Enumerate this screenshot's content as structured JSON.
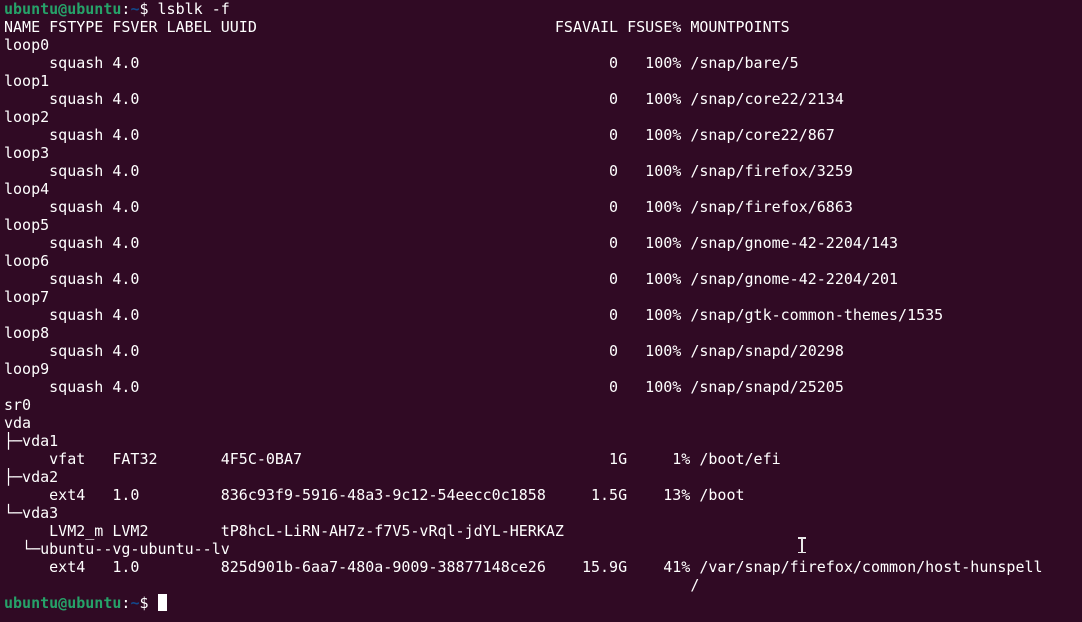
{
  "prompt": {
    "user_host": "ubuntu@ubuntu",
    "colon": ":",
    "path": "~",
    "dollar": "$ "
  },
  "command": "lsblk -f",
  "output_lines": [
    "NAME FSTYPE FSVER LABEL UUID                                 FSAVAIL FSUSE% MOUNTPOINTS",
    "loop0",
    "     squash 4.0                                                    0   100% /snap/bare/5",
    "loop1",
    "     squash 4.0                                                    0   100% /snap/core22/2134",
    "loop2",
    "     squash 4.0                                                    0   100% /snap/core22/867",
    "loop3",
    "     squash 4.0                                                    0   100% /snap/firefox/3259",
    "loop4",
    "     squash 4.0                                                    0   100% /snap/firefox/6863",
    "loop5",
    "     squash 4.0                                                    0   100% /snap/gnome-42-2204/143",
    "loop6",
    "     squash 4.0                                                    0   100% /snap/gnome-42-2204/201",
    "loop7",
    "     squash 4.0                                                    0   100% /snap/gtk-common-themes/1535",
    "loop8",
    "     squash 4.0                                                    0   100% /snap/snapd/20298",
    "loop9",
    "     squash 4.0                                                    0   100% /snap/snapd/25205",
    "sr0",
    "vda",
    "├─vda1",
    "     vfat   FAT32       4F5C-0BA7                                  1G     1% /boot/efi",
    "├─vda2",
    "     ext4   1.0         836c93f9-5916-48a3-9c12-54eecc0c1858     1.5G    13% /boot",
    "└─vda3",
    "     LVM2_m LVM2        tP8hcL-LiRN-AH7z-f7V5-vRql-jdYL-HERKAZ",
    "  └─ubuntu--vg-ubuntu--lv",
    "     ext4   1.0         825d901b-6aa7-480a-9009-38877148ce26    15.9G    41% /var/snap/firefox/common/host-hunspell",
    "                                                                            /"
  ],
  "colors": {
    "background": "#300a24",
    "foreground": "#ffffff",
    "user_host": "#26a269",
    "path": "#12488b"
  },
  "icons": {
    "mouse_pointer": "text-cursor-ibeam-icon"
  }
}
